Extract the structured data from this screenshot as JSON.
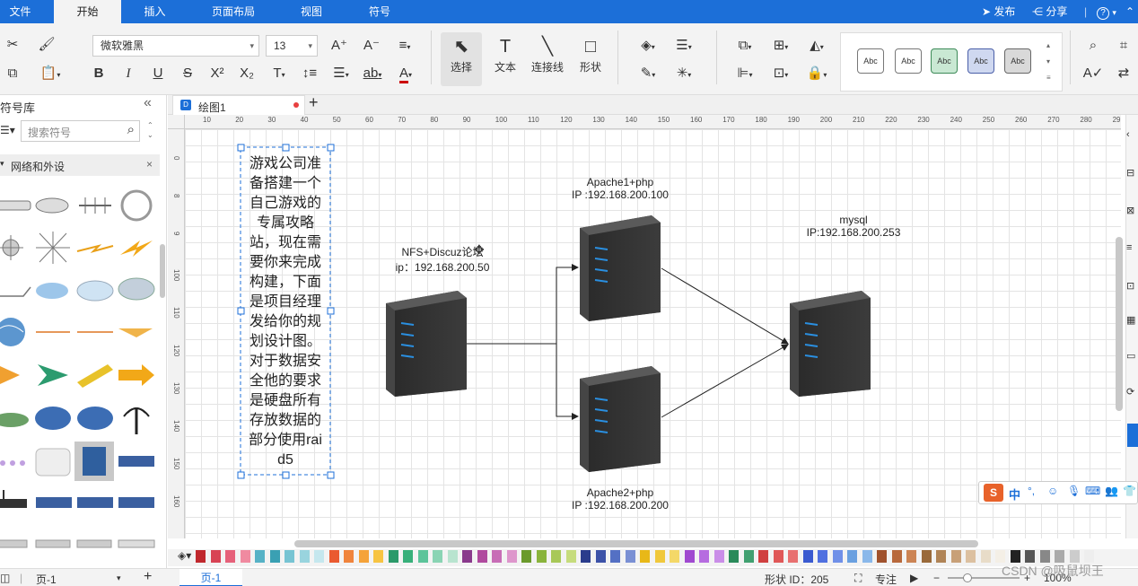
{
  "menubar": {
    "tabs": [
      "文件",
      "开始",
      "插入",
      "页面布局",
      "视图",
      "符号"
    ],
    "active_tab": "开始",
    "publish": "发布",
    "share": "分享",
    "help": "?"
  },
  "ribbon": {
    "font_family": "微软雅黑",
    "font_size": "13",
    "select_label": "选择",
    "text_label": "文本",
    "connector_label": "连接线",
    "shape_label": "形状",
    "style_presets": [
      "Abc",
      "Abc",
      "Abc",
      "Abc",
      "Abc"
    ]
  },
  "library": {
    "title": "符号库",
    "search_placeholder": "搜索符号",
    "category": "网络和外设"
  },
  "document": {
    "tab_name": "绘图1",
    "add_tab": "+"
  },
  "ruler": {
    "h_ticks": [
      "10",
      "20",
      "30",
      "40",
      "50",
      "60",
      "70",
      "80",
      "90",
      "100",
      "110",
      "120",
      "130",
      "140",
      "150",
      "160",
      "170",
      "180",
      "190",
      "200",
      "210",
      "220",
      "230",
      "240",
      "250",
      "260",
      "270",
      "280",
      "29"
    ],
    "v_ticks": [
      "0",
      "8",
      "9",
      "100",
      "110",
      "120",
      "130",
      "140",
      "150",
      "160"
    ]
  },
  "diagram": {
    "note_text": "游戏公司准备搭建一个自己游戏的专属攻略站，现在需要你来完成构建，下面是项目经理发给你的规划设计图。对于数据安全他的要求是硬盘所有存放数据的部分使用raid5",
    "nfs_label_line1": "NFS+Discuz论坛",
    "nfs_label_line2": "ip：192.168.200.50",
    "apache1_line1": "Apache1+php",
    "apache1_line2": "IP :192.168.200.100",
    "apache2_line1": "Apache2+php",
    "apache2_line2": "IP :192.168.200.200",
    "mysql_line1": "mysql",
    "mysql_line2": "IP:192.168.200.253"
  },
  "statusbar": {
    "page_selector": "页-1",
    "page_tab": "页-1",
    "add_page": "+",
    "shape_id": "形状 ID：205",
    "focus": "专注",
    "zoom": "100%",
    "watermark": "CSDN @吸鼠坝王"
  },
  "ime": {
    "mode": "中"
  },
  "colors": {
    "accent": "#1c6fd8",
    "selection": "#1c6fd8",
    "server_dark": "#3a3a3a",
    "server_led": "#2a8fe0"
  }
}
